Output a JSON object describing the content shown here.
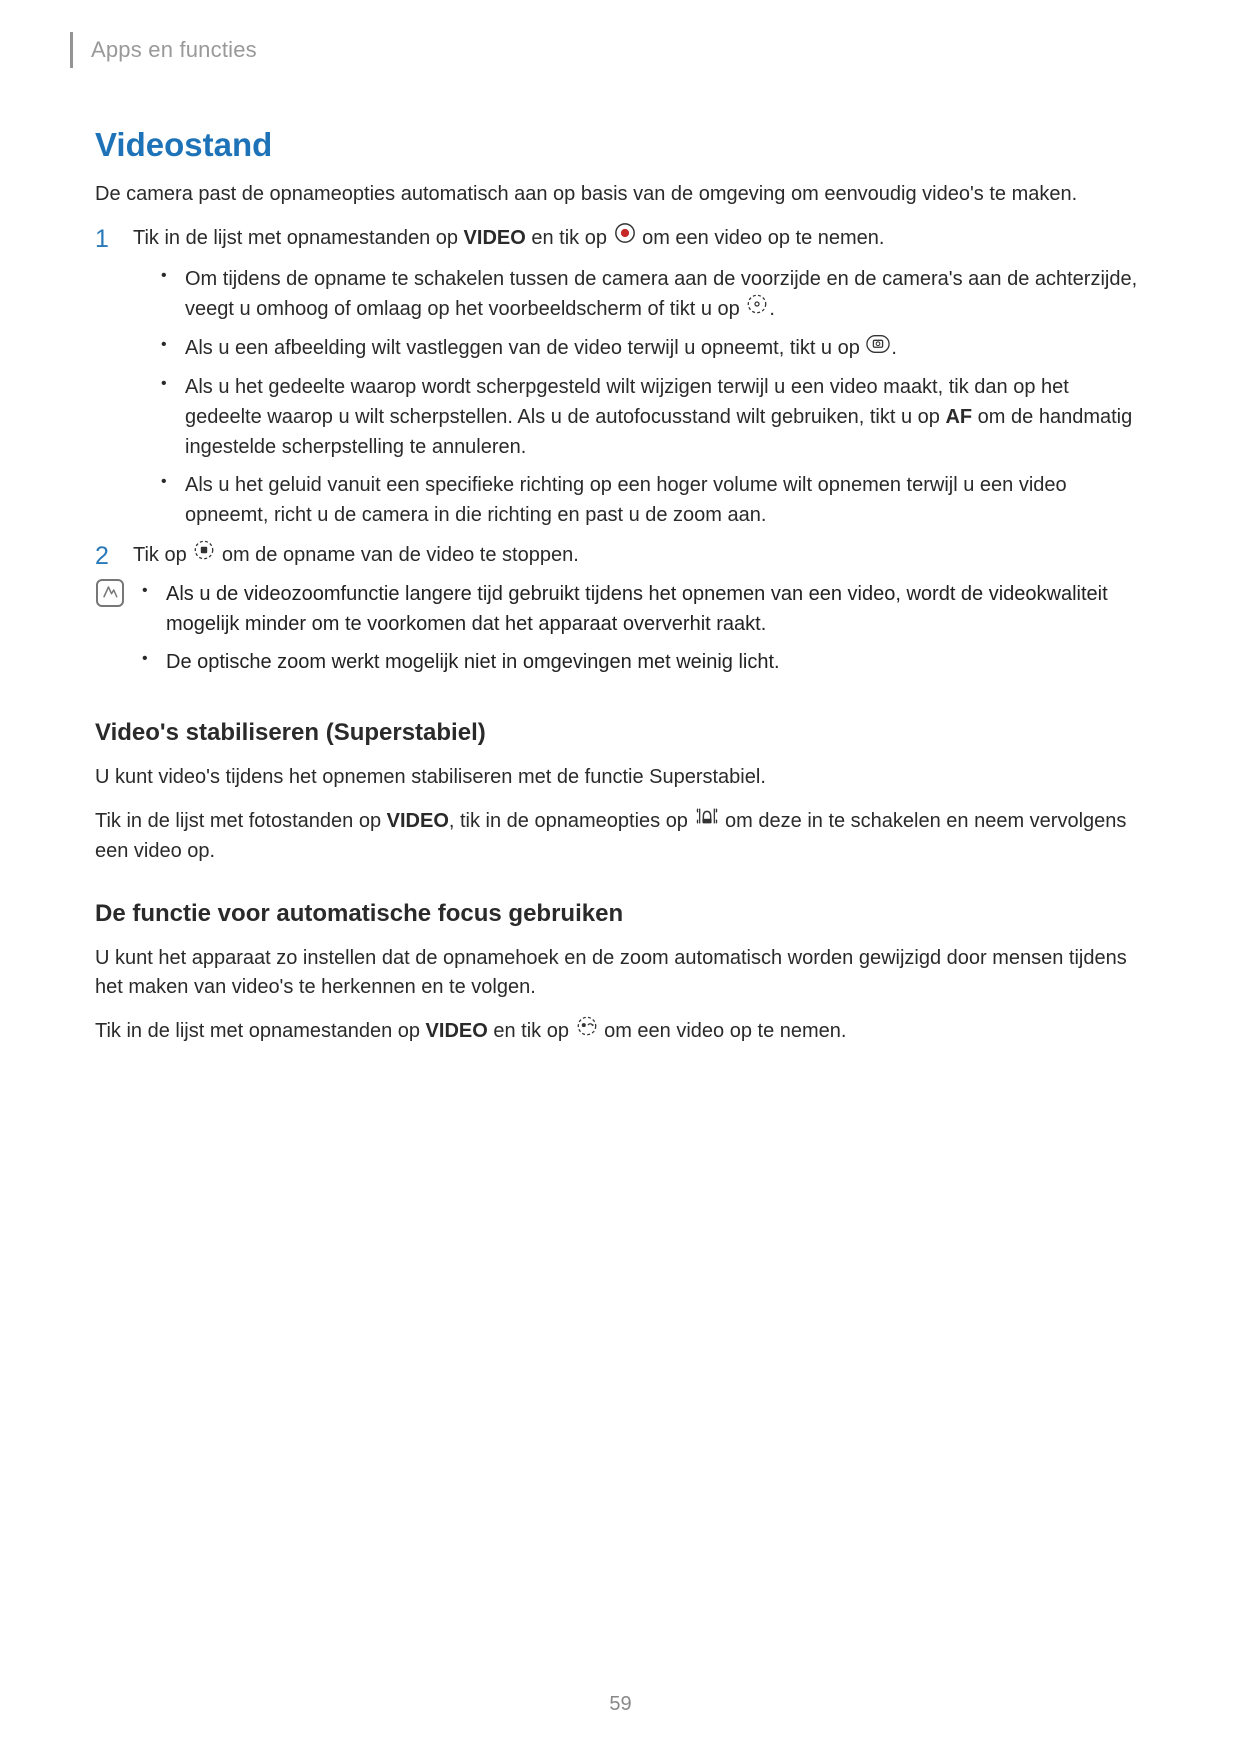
{
  "header": {
    "breadcrumb": "Apps en functies"
  },
  "section": {
    "title": "Videostand",
    "intro": "De camera past de opnameopties automatisch aan op basis van de omgeving om eenvoudig video's te maken."
  },
  "step1": {
    "num": "1",
    "pre": "Tik in de lijst met opnamestanden op ",
    "bold": "VIDEO",
    "mid": " en tik op ",
    "post": " om een video op te nemen.",
    "bullets": {
      "b1a": "Om tijdens de opname te schakelen tussen de camera aan de voorzijde en de camera's aan de achterzijde, veegt u omhoog of omlaag op het voorbeeldscherm of tikt u op ",
      "b1b": ".",
      "b2a": "Als u een afbeelding wilt vastleggen van de video terwijl u opneemt, tikt u op ",
      "b2b": ".",
      "b3a": "Als u het gedeelte waarop wordt scherpgesteld wilt wijzigen terwijl u een video maakt, tik dan op het gedeelte waarop u wilt scherpstellen. Als u de autofocusstand wilt gebruiken, tikt u op ",
      "b3bold": "AF",
      "b3b": " om de handmatig ingestelde scherpstelling te annuleren.",
      "b4": "Als u het geluid vanuit een specifieke richting op een hoger volume wilt opnemen terwijl u een video opneemt, richt u de camera in die richting en past u de zoom aan."
    }
  },
  "step2": {
    "num": "2",
    "pre": "Tik op ",
    "post": " om de opname van de video te stoppen."
  },
  "note": {
    "b1": "Als u de videozoomfunctie langere tijd gebruikt tijdens het opnemen van een video, wordt de videokwaliteit mogelijk minder om te voorkomen dat het apparaat oververhit raakt.",
    "b2": "De optische zoom werkt mogelijk niet in omgevingen met weinig licht."
  },
  "sub1": {
    "heading": "Video's stabiliseren (Superstabiel)",
    "p1": "U kunt video's tijdens het opnemen stabiliseren met de functie Superstabiel.",
    "p2a": "Tik in de lijst met fotostanden op ",
    "p2bold": "VIDEO",
    "p2b": ", tik in de opnameopties op ",
    "p2c": " om deze in te schakelen en neem vervolgens een video op."
  },
  "sub2": {
    "heading": "De functie voor automatische focus gebruiken",
    "p1": "U kunt het apparaat zo instellen dat de opnamehoek en de zoom automatisch worden gewijzigd door mensen tijdens het maken van video's te herkennen en te volgen.",
    "p2a": "Tik in de lijst met opnamestanden op ",
    "p2bold": "VIDEO",
    "p2b": " en tik op ",
    "p2c": " om een video op te nemen."
  },
  "pagenum": "59"
}
